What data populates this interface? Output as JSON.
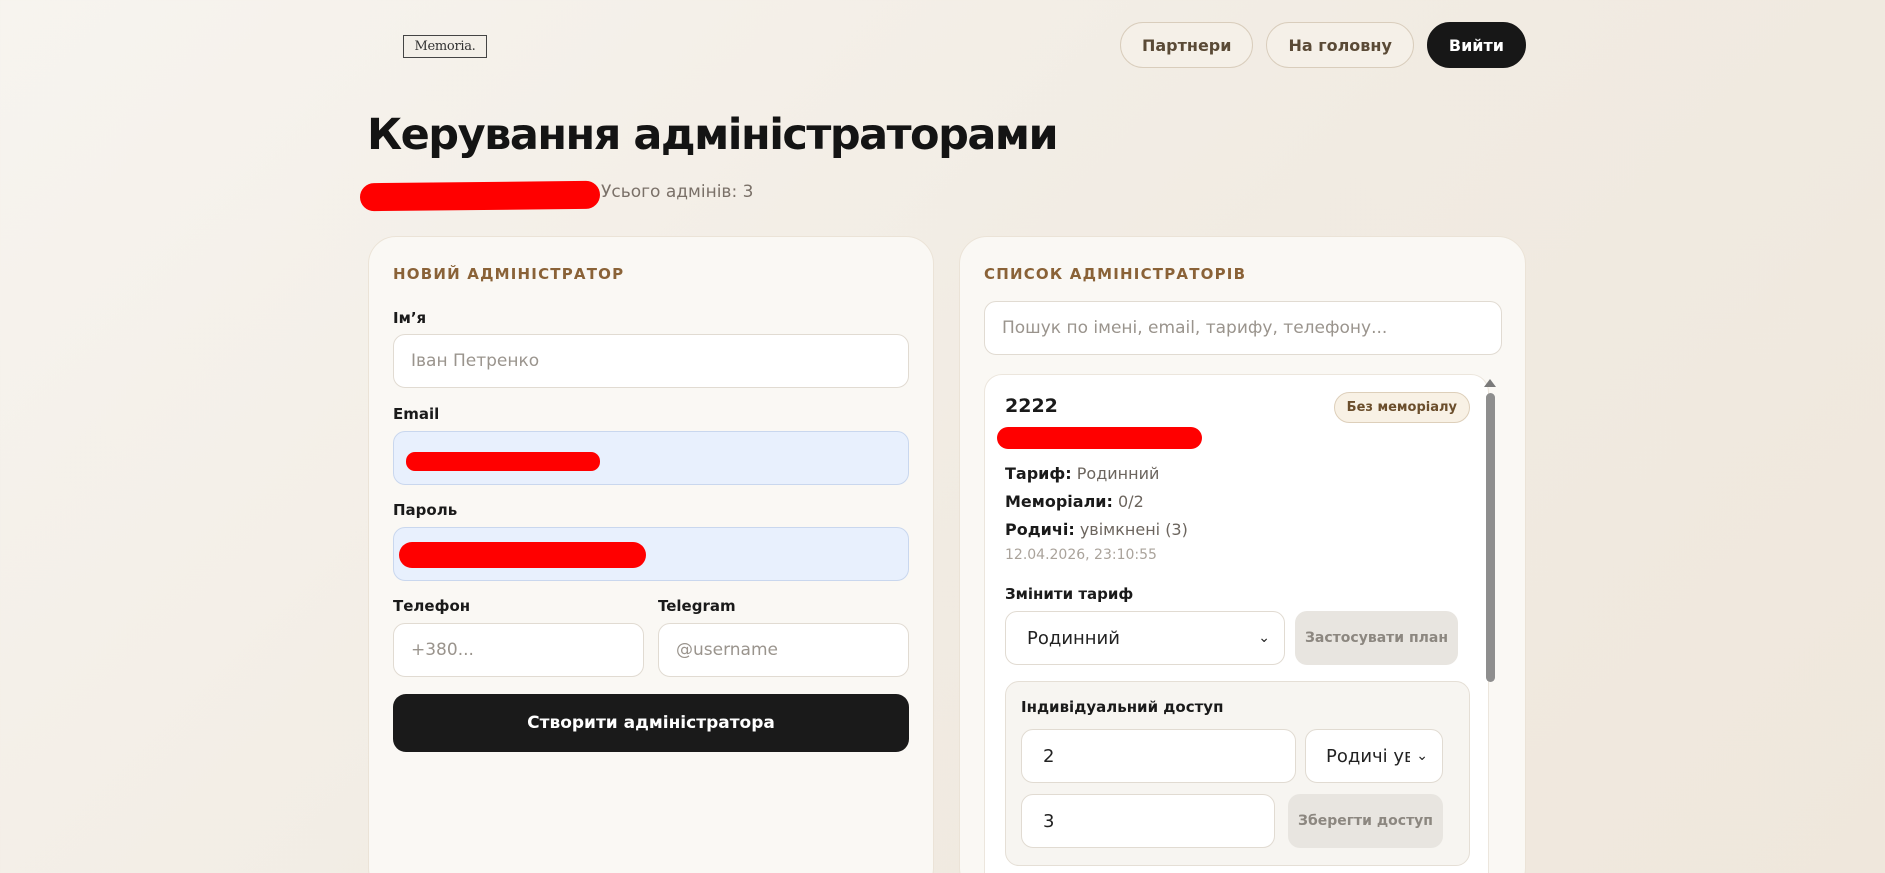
{
  "header": {
    "logo_text": "Memoria.",
    "nav": {
      "partners": "Партнери",
      "home": "На головну",
      "logout": "Вийти"
    }
  },
  "page": {
    "title": "Керування адміністраторами",
    "total_admins": "Усього адмінів: 3"
  },
  "new_admin": {
    "title": "НОВИЙ АДМІНІСТРАТОР",
    "name_label": "Ім’я",
    "name_placeholder": "Іван Петренко",
    "email_label": "Email",
    "password_label": "Пароль",
    "phone_label": "Телефон",
    "phone_placeholder": "+380...",
    "telegram_label": "Telegram",
    "telegram_placeholder": "@username",
    "submit_label": "Створити адміністратора"
  },
  "admin_list": {
    "title": "СПИСОК АДМІНІСТРАТОРІВ",
    "search_placeholder": "Пошук по імені, email, тарифу, телефону...",
    "card": {
      "name": "2222",
      "badge": "Без меморіалу",
      "tariff_label": "Тариф:",
      "tariff_value": "Родинний",
      "memorials_label": "Меморіали:",
      "memorials_value": "0/2",
      "relatives_label": "Родичі:",
      "relatives_value": "увімкнені (3)",
      "date": "12.04.2026, 23:10:55",
      "change_tariff_label": "Змінити тариф",
      "tariff_select_value": "Родинний",
      "apply_plan_label": "Застосувати план",
      "individual_access_label": "Індивідуальний доступ",
      "memorials_input_value": "2",
      "relatives_select_value": "Родичі ув",
      "relatives_input_value": "3",
      "save_access_label": "Зберегти доступ"
    }
  },
  "colors": {
    "accent_brown": "#8a6237",
    "dark_button": "#171717",
    "autofill_bg": "#e8f0fd",
    "redaction": "#ff0000"
  },
  "icons": {
    "select_arrow": "chevron-down-icon",
    "scroll_up": "scroll-up-arrow-icon"
  }
}
